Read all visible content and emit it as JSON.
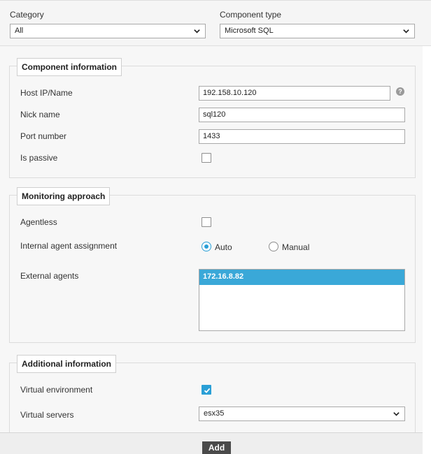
{
  "filters": {
    "category_label": "Category",
    "category_value": "All",
    "component_type_label": "Component type",
    "component_type_value": "Microsoft SQL"
  },
  "component_information": {
    "legend": "Component information",
    "host_label": "Host IP/Name",
    "host_value": "192.158.10.120",
    "nick_label": "Nick name",
    "nick_value": "sql120",
    "port_label": "Port number",
    "port_value": "1433",
    "passive_label": "Is passive",
    "passive_checked": false
  },
  "monitoring_approach": {
    "legend": "Monitoring approach",
    "agentless_label": "Agentless",
    "agentless_checked": false,
    "assignment_label": "Internal agent assignment",
    "auto_label": "Auto",
    "manual_label": "Manual",
    "selected": "Auto",
    "external_label": "External agents",
    "external_agents": [
      "172.16.8.82"
    ]
  },
  "additional_information": {
    "legend": "Additional information",
    "virtual_env_label": "Virtual environment",
    "virtual_env_checked": true,
    "virtual_servers_label": "Virtual servers",
    "virtual_servers_value": "esx35"
  },
  "actions": {
    "add_label": "Add"
  },
  "colors": {
    "accent": "#2a9fd6",
    "selected_option": "#3aa8d8",
    "button": "#4a4a4a"
  },
  "icons": {
    "dropdown": "chevron-down-icon",
    "help": "help-icon",
    "check": "check-icon"
  }
}
